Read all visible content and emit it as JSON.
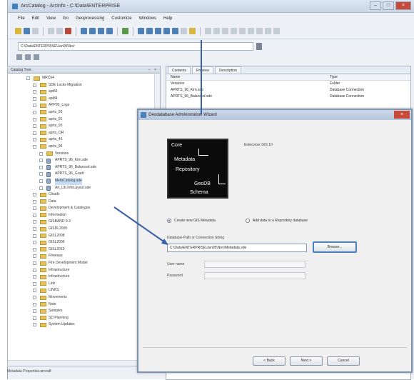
{
  "window": {
    "title": "ArcCatalog - ArcInfo - C:\\Data\\ENTERPRISE"
  },
  "menu": [
    "File",
    "Edit",
    "View",
    "Go",
    "Geoprocessing",
    "Customize",
    "Windows",
    "Help"
  ],
  "location": {
    "value": "C:\\Data\\ENTERPRISE\\Jan05\\Nov"
  },
  "tree": {
    "title": "Catalog Tree",
    "panel_buttons": "− ×",
    "items": [
      {
        "label": "MRC64",
        "depth": 0,
        "type": "folder"
      },
      {
        "label": "SDE Locks Migration",
        "depth": 1,
        "type": "folder"
      },
      {
        "label": "apt66",
        "depth": 1,
        "type": "folder"
      },
      {
        "label": "apt84",
        "depth": 1,
        "type": "folder"
      },
      {
        "label": "APP95_Logs",
        "depth": 1,
        "type": "folder"
      },
      {
        "label": "aprts_93",
        "depth": 1,
        "type": "folder"
      },
      {
        "label": "aprts_91",
        "depth": 1,
        "type": "folder"
      },
      {
        "label": "aprts_93",
        "depth": 1,
        "type": "folder"
      },
      {
        "label": "aprts_OR",
        "depth": 1,
        "type": "folder"
      },
      {
        "label": "aprts_46",
        "depth": 1,
        "type": "folder"
      },
      {
        "label": "aprts_96",
        "depth": 1,
        "type": "folder"
      },
      {
        "label": "Versions",
        "depth": 2,
        "type": "folder"
      },
      {
        "label": "APRTS_96_Kirn.sde",
        "depth": 2,
        "type": "db"
      },
      {
        "label": "APRTS_96_Balanced.sde",
        "depth": 2,
        "type": "db"
      },
      {
        "label": "APRTS_96_Gradt",
        "depth": 2,
        "type": "db"
      },
      {
        "label": "MetaCatalog.sde",
        "depth": 2,
        "type": "db",
        "selected": true
      },
      {
        "label": "Art_Lib.InfoLayout.sde",
        "depth": 2,
        "type": "db"
      },
      {
        "label": "Cloudx",
        "depth": 1,
        "type": "folder"
      },
      {
        "label": "Data",
        "depth": 1,
        "type": "folder"
      },
      {
        "label": "Development & Catalogue",
        "depth": 1,
        "type": "folder"
      },
      {
        "label": "Information",
        "depth": 1,
        "type": "folder"
      },
      {
        "label": "GISBAND 9.3",
        "depth": 1,
        "type": "folder"
      },
      {
        "label": "GISDL2005",
        "depth": 1,
        "type": "folder"
      },
      {
        "label": "GISL2008",
        "depth": 1,
        "type": "folder"
      },
      {
        "label": "GISL2006",
        "depth": 1,
        "type": "folder"
      },
      {
        "label": "GISL2010",
        "depth": 1,
        "type": "folder"
      },
      {
        "label": "Ffreeaus",
        "depth": 1,
        "type": "folder"
      },
      {
        "label": "Fire Development Model",
        "depth": 1,
        "type": "folder"
      },
      {
        "label": "Infrastructure",
        "depth": 1,
        "type": "folder"
      },
      {
        "label": "Infrastructure",
        "depth": 1,
        "type": "folder"
      },
      {
        "label": "Link",
        "depth": 1,
        "type": "folder"
      },
      {
        "label": "LINKS",
        "depth": 1,
        "type": "folder"
      },
      {
        "label": "Movements",
        "depth": 1,
        "type": "folder"
      },
      {
        "label": "Note",
        "depth": 1,
        "type": "folder"
      },
      {
        "label": "Samples",
        "depth": 1,
        "type": "folder"
      },
      {
        "label": "SD Planning",
        "depth": 1,
        "type": "folder"
      },
      {
        "label": "System Updates",
        "depth": 1,
        "type": "folder"
      }
    ]
  },
  "status": "Metadata Properties.aircraft",
  "contents": {
    "tabs": [
      "Contents",
      "Preview",
      "Description"
    ],
    "columns": [
      "Name",
      "Type"
    ],
    "rows": [
      {
        "name": "Versions",
        "type": "Folder"
      },
      {
        "name": "APRTS_96_Kirn.sde",
        "type": "Database Connection"
      },
      {
        "name": "APRTS_96_Balanced.sde",
        "type": "Database Connection"
      }
    ]
  },
  "dialog": {
    "title": "Geodatabase Administration Wizard",
    "image_lines": [
      "Core",
      "Metadata",
      "Repository",
      "GeoDB",
      "Schema"
    ],
    "section_label": "Enterprise GIS 10",
    "radio_options": [
      "Create new GIS Metadata",
      "Add data to a Repository database"
    ],
    "path_label": "Database Path or Connection String",
    "path_value": "C:\\Data\\ENTERPRISE\\Jan05\\Nov\\Metadata.sde",
    "browse_label": "Browse...",
    "username_label": "User name",
    "password_label": "Password",
    "buttons": [
      "< Back",
      "Next >",
      "Cancel"
    ]
  },
  "colors": {
    "accent": "#4a7fbf",
    "folder": "#e4c35a",
    "close": "#c84a3a"
  }
}
